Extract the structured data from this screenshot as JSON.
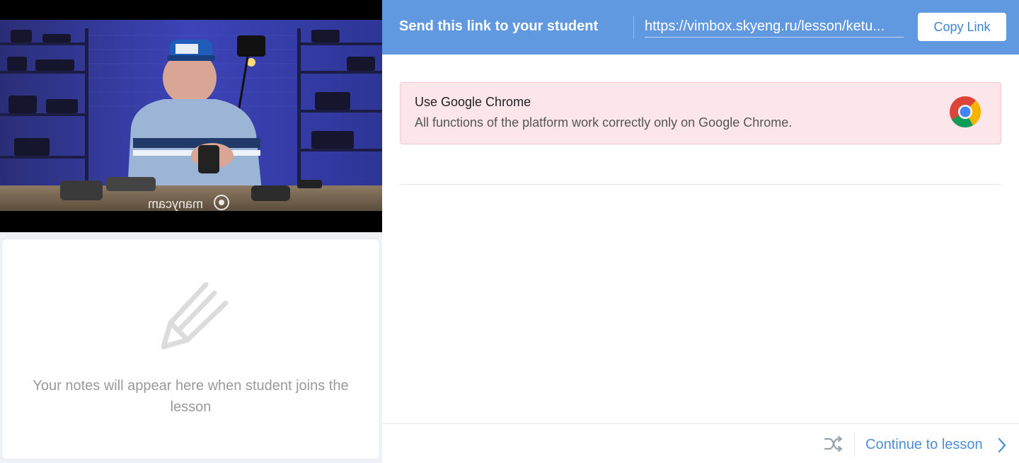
{
  "video": {
    "watermark": "manycam"
  },
  "notes": {
    "icon": "pencil-icon",
    "placeholder": "Your notes will appear here when student joins the lesson"
  },
  "topbar": {
    "send_label": "Send this link to your student",
    "link": "https://vimbox.skyeng.ru/lesson/ketu...",
    "copy_label": "Copy Link",
    "bg_color": "#6199e0"
  },
  "alert": {
    "title": "Use Google Chrome",
    "body": "All functions of the platform work correctly only on Google Chrome.",
    "icon": "chrome-logo-icon",
    "bg_color": "#fde6ea"
  },
  "footer": {
    "shuffle_icon": "shuffle-icon",
    "continue_label": "Continue to lesson",
    "chevron_icon": "chevron-right-icon",
    "accent_color": "#4b8fd6"
  }
}
